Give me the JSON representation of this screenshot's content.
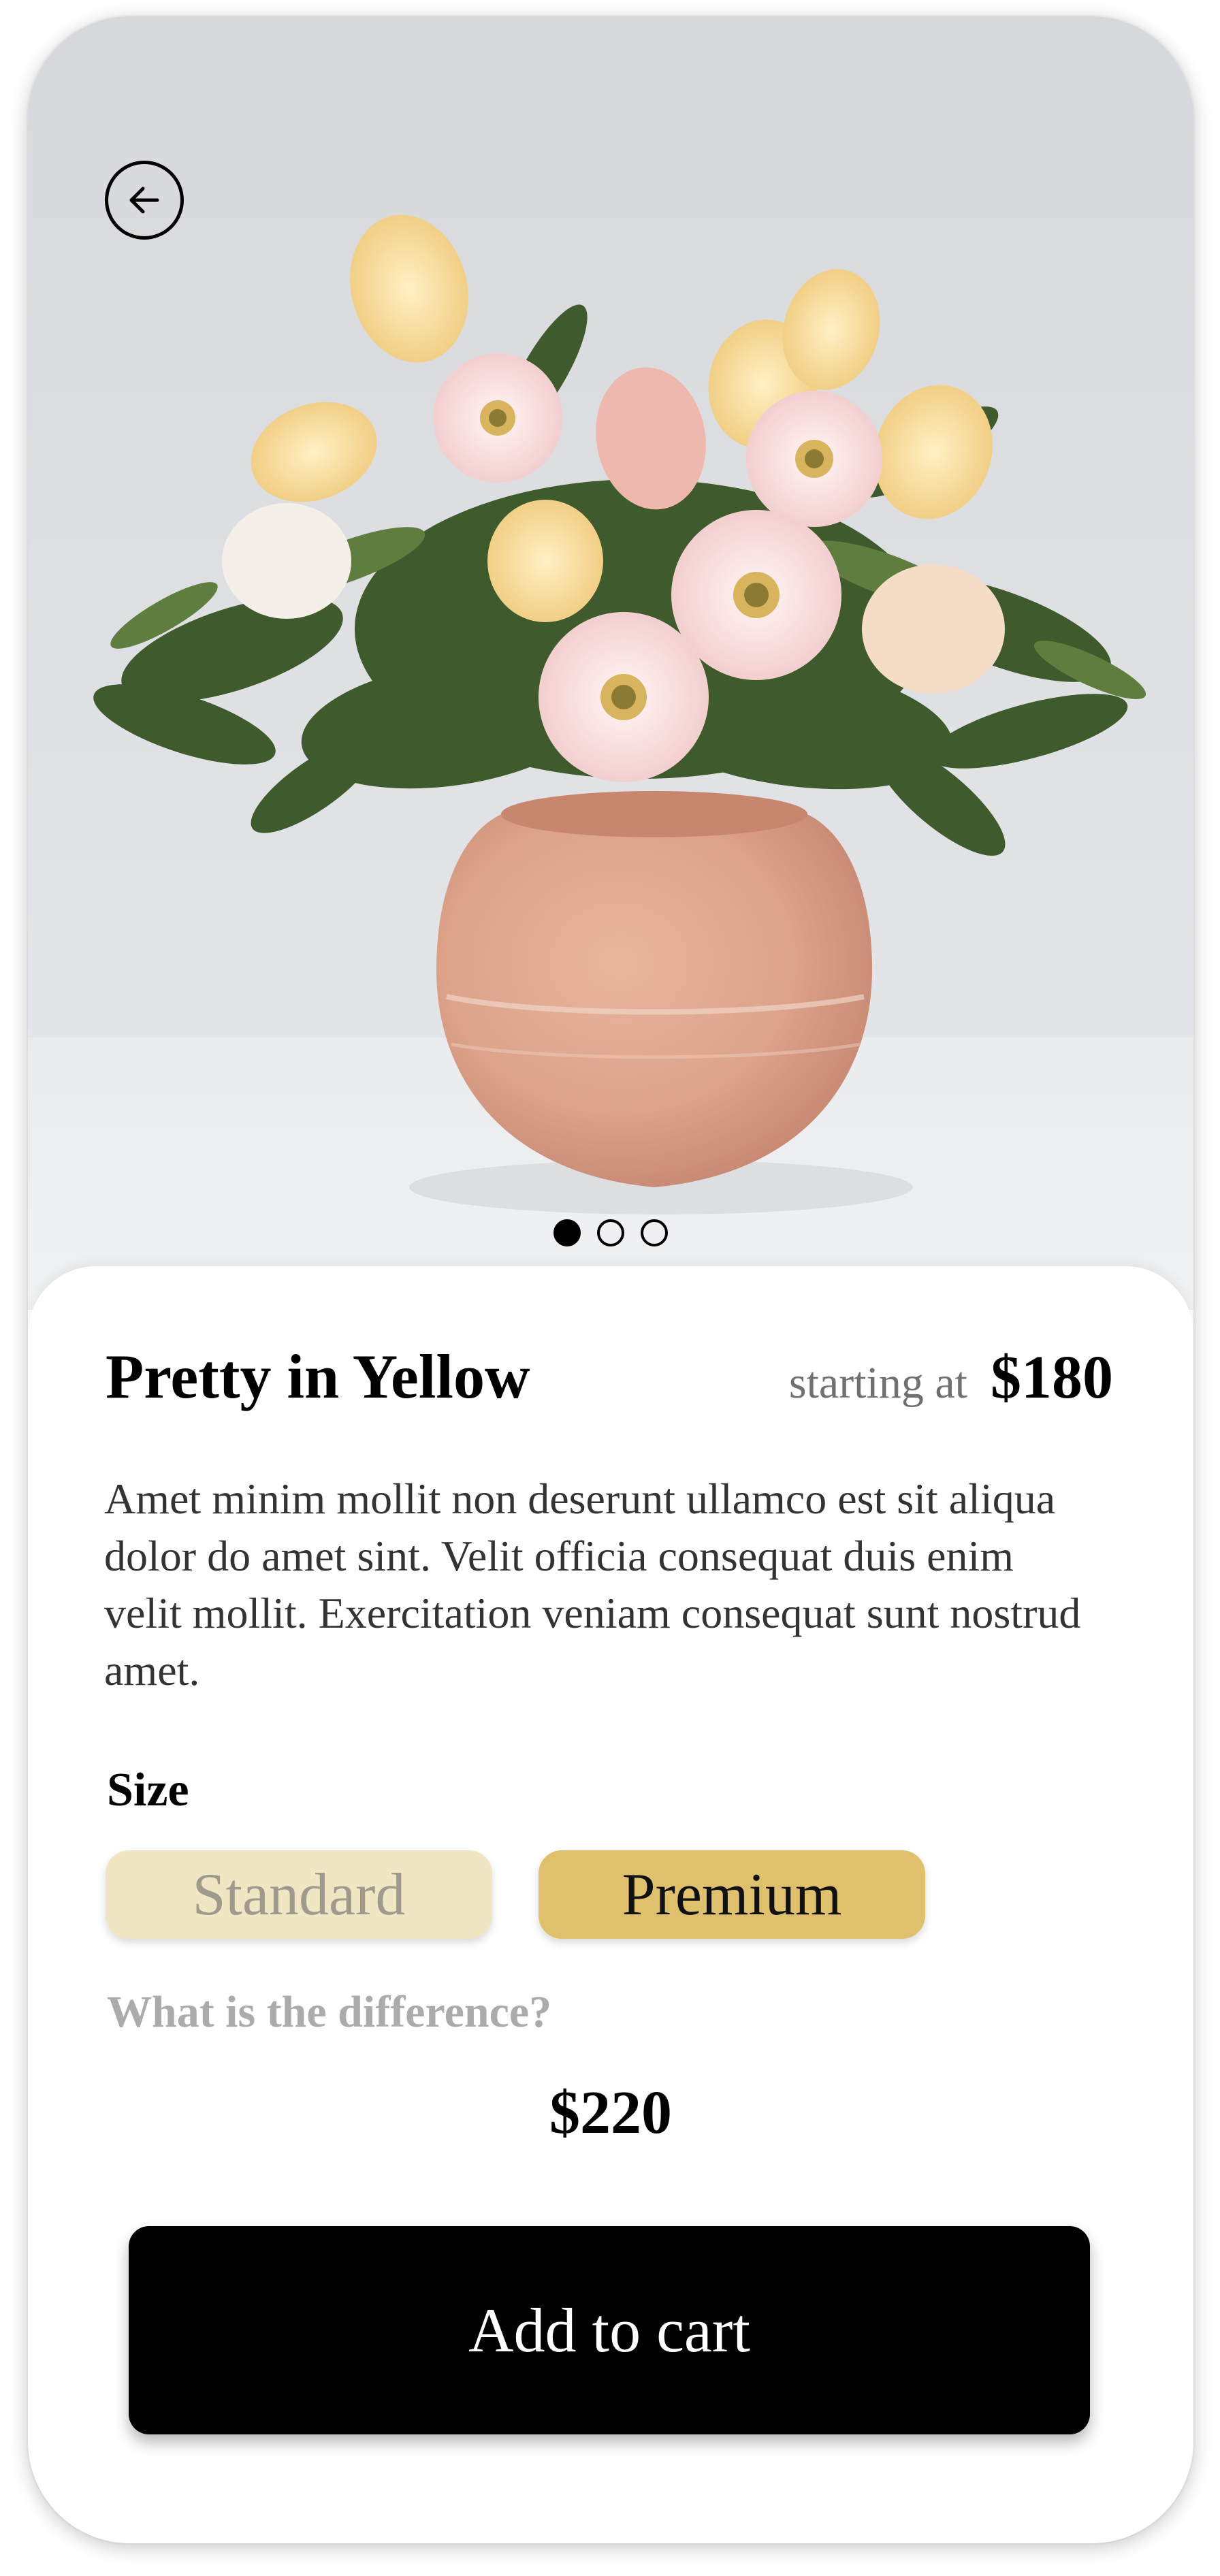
{
  "product": {
    "title": "Pretty in Yellow",
    "starting_at_label": "starting at",
    "base_price": "$180",
    "description": "Amet minim mollit non deserunt ullamco est sit aliqua dolor do amet sint. Velit officia consequat duis enim velit mollit. Exercitation veniam consequat sunt nostrud amet."
  },
  "gallery": {
    "image_count": 3,
    "active_index": 0
  },
  "size": {
    "label": "Size",
    "options": [
      "Standard",
      "Premium"
    ],
    "selected": "Premium",
    "difference_link": "What is the difference?",
    "selected_price": "$220"
  },
  "actions": {
    "add_to_cart_label": "Add to cart"
  },
  "icons": {
    "back": "arrow-left-circle-icon"
  },
  "colors": {
    "standard_bg": "#f1e6c4",
    "premium_bg": "#dfc16d",
    "cart_bg": "#000000"
  }
}
